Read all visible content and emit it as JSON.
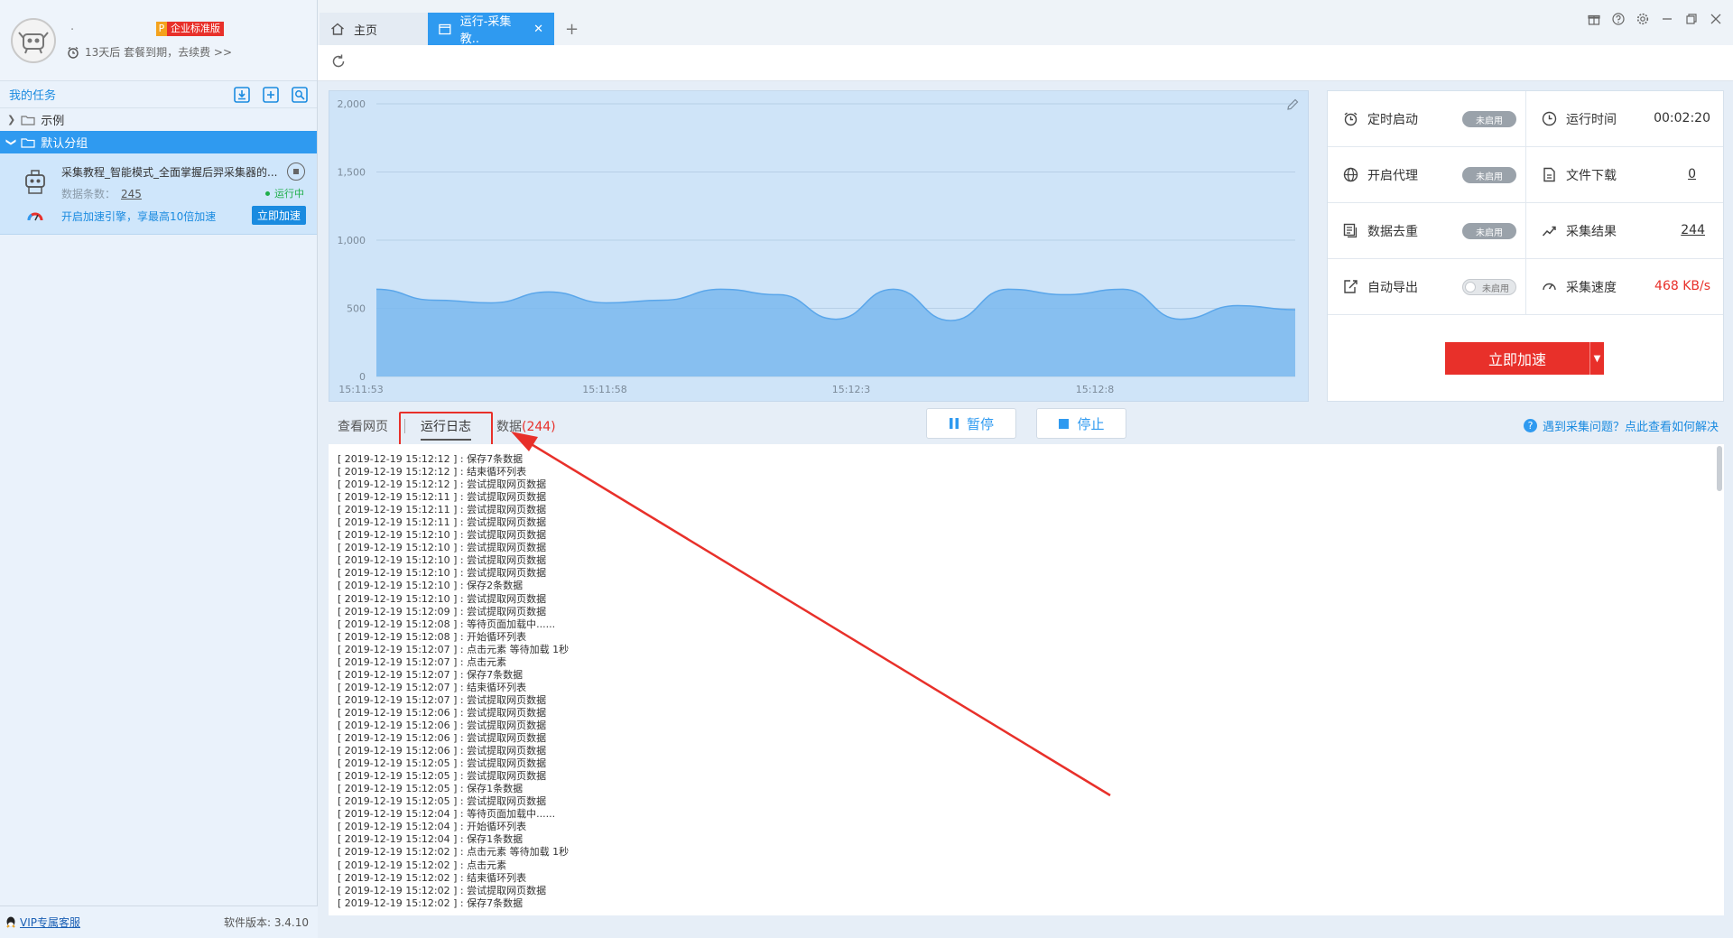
{
  "profile": {
    "username": ".",
    "edition_badge": "P",
    "edition_label": "企业标准版",
    "expire_text": "13天后 套餐到期，去续费 >>"
  },
  "sidebar": {
    "title": "我的任务",
    "tools": [
      "import-icon",
      "add-task-icon",
      "search-task-icon"
    ],
    "groups": [
      {
        "label": "示例",
        "expanded": false
      },
      {
        "label": "默认分组",
        "expanded": true
      }
    ],
    "task": {
      "name": "采集教程_智能模式_全面掌握后羿采集器的...",
      "count_label": "数据条数：",
      "count_value": "245",
      "status": "运行中",
      "boost_tip": "开启加速引擎，享最高10倍加速",
      "boost_button": "立即加速"
    },
    "footer": {
      "vip_link": "VIP专属客服",
      "version": "软件版本: 3.4.10"
    }
  },
  "tabs": [
    {
      "label": "主页",
      "icon": "home-icon"
    },
    {
      "label": "运行-采集教..",
      "icon": "window-icon",
      "active": true
    }
  ],
  "window_controls": [
    "gift-icon",
    "help-icon",
    "settings-icon",
    "minimize-icon",
    "restore-icon",
    "close-icon"
  ],
  "chart_data": {
    "type": "area",
    "x_ticks": [
      "15:11:53",
      "15:11:58",
      "15:12:3",
      "15:12:8"
    ],
    "y_ticks": [
      "2,000",
      "1,500",
      "1,000",
      "500",
      "0"
    ],
    "ylim": [
      0,
      2000
    ],
    "values": [
      640,
      560,
      540,
      620,
      540,
      560,
      640,
      600,
      420,
      640,
      410,
      640,
      600,
      640,
      420,
      520,
      490
    ],
    "color": "#7ab8ee"
  },
  "stats": {
    "schedule": {
      "label": "定时启动",
      "state": "未启用"
    },
    "run_time": {
      "label": "运行时间",
      "value": "00:02:20"
    },
    "proxy": {
      "label": "开启代理",
      "state": "未启用"
    },
    "file_download": {
      "label": "文件下载",
      "value": "0"
    },
    "dedupe": {
      "label": "数据去重",
      "state": "未启用"
    },
    "results": {
      "label": "采集结果",
      "value": "244"
    },
    "auto_export": {
      "label": "自动导出",
      "state": "未启用"
    },
    "speed": {
      "label": "采集速度",
      "value": "468 KB/s"
    },
    "accelerate_button": "立即加速"
  },
  "subtabs": {
    "web": "查看网页",
    "log": "运行日志",
    "data": "数据",
    "data_count": "(244)",
    "pause": "暂停",
    "stop": "停止",
    "help": "遇到采集问题？点此查看如何解决"
  },
  "log": [
    "[ 2019-12-19 15:12:12 ] : 保存7条数据",
    "[ 2019-12-19 15:12:12 ] : 结束循环列表",
    "[ 2019-12-19 15:12:12 ] : 尝试提取网页数据",
    "[ 2019-12-19 15:12:11 ] : 尝试提取网页数据",
    "[ 2019-12-19 15:12:11 ] : 尝试提取网页数据",
    "[ 2019-12-19 15:12:11 ] : 尝试提取网页数据",
    "[ 2019-12-19 15:12:10 ] : 尝试提取网页数据",
    "[ 2019-12-19 15:12:10 ] : 尝试提取网页数据",
    "[ 2019-12-19 15:12:10 ] : 尝试提取网页数据",
    "[ 2019-12-19 15:12:10 ] : 尝试提取网页数据",
    "[ 2019-12-19 15:12:10 ] : 保存2条数据",
    "[ 2019-12-19 15:12:10 ] : 尝试提取网页数据",
    "[ 2019-12-19 15:12:09 ] : 尝试提取网页数据",
    "[ 2019-12-19 15:12:08 ] : 等待页面加载中......",
    "[ 2019-12-19 15:12:08 ] : 开始循环列表",
    "[ 2019-12-19 15:12:07 ] : 点击元素 等待加载 1秒",
    "[ 2019-12-19 15:12:07 ] : 点击元素",
    "[ 2019-12-19 15:12:07 ] : 保存7条数据",
    "[ 2019-12-19 15:12:07 ] : 结束循环列表",
    "[ 2019-12-19 15:12:07 ] : 尝试提取网页数据",
    "[ 2019-12-19 15:12:06 ] : 尝试提取网页数据",
    "[ 2019-12-19 15:12:06 ] : 尝试提取网页数据",
    "[ 2019-12-19 15:12:06 ] : 尝试提取网页数据",
    "[ 2019-12-19 15:12:06 ] : 尝试提取网页数据",
    "[ 2019-12-19 15:12:05 ] : 尝试提取网页数据",
    "[ 2019-12-19 15:12:05 ] : 尝试提取网页数据",
    "[ 2019-12-19 15:12:05 ] : 保存1条数据",
    "[ 2019-12-19 15:12:05 ] : 尝试提取网页数据",
    "[ 2019-12-19 15:12:04 ] : 等待页面加载中......",
    "[ 2019-12-19 15:12:04 ] : 开始循环列表",
    "[ 2019-12-19 15:12:04 ] : 保存1条数据",
    "[ 2019-12-19 15:12:02 ] : 点击元素 等待加载 1秒",
    "[ 2019-12-19 15:12:02 ] : 点击元素",
    "[ 2019-12-19 15:12:02 ] : 结束循环列表",
    "[ 2019-12-19 15:12:02 ] : 尝试提取网页数据",
    "[ 2019-12-19 15:12:02 ] : 保存7条数据"
  ],
  "colors": {
    "accent": "#2f9af0",
    "danger": "#e8302a",
    "running": "#1fae4a"
  }
}
